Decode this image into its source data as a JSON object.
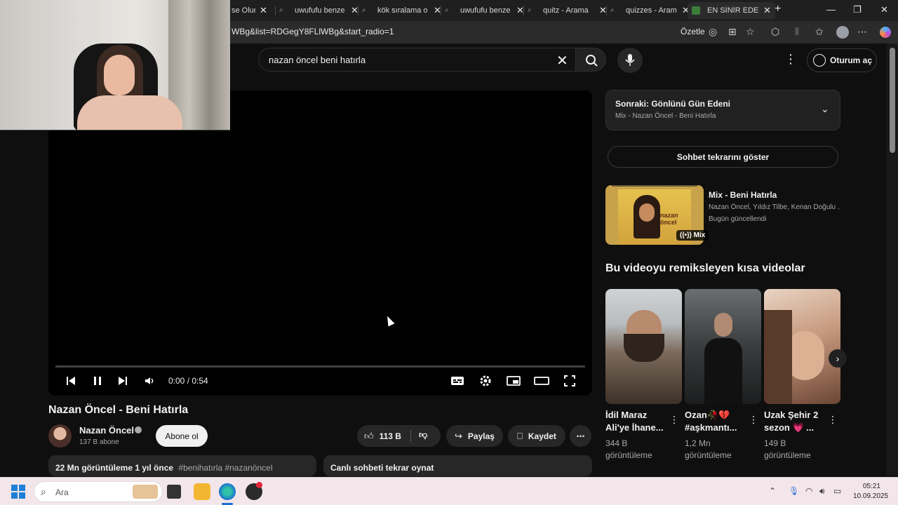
{
  "browser": {
    "tabs": [
      {
        "title": "se Olur",
        "icon": "generic-icon"
      },
      {
        "title": "uwufufu benze",
        "icon": "search-icon"
      },
      {
        "title": "kök sıralama o",
        "icon": "search-icon"
      },
      {
        "title": "uwufufu benze",
        "icon": "search-icon"
      },
      {
        "title": "quitz - Arama",
        "icon": "search-icon"
      },
      {
        "title": "quizzes - Aram",
        "icon": "search-icon"
      },
      {
        "title": "EN SİNİR EDEN",
        "icon": "game-icon"
      }
    ],
    "url": "WBg&list=RDGegY8FLlWBg&start_radio=1",
    "summarize_label": "Özetle"
  },
  "masthead": {
    "search_query": "nazan öncel beni hatırla",
    "signin_label": "Oturum aç"
  },
  "player": {
    "time": "0:00 / 0:54",
    "progress_fraction": 0.0
  },
  "video": {
    "title": "Nazan Öncel - Beni Hatırla",
    "channel": "Nazan Öncel",
    "subscribers": "137 B abone",
    "subscribe_label": "Abone ol",
    "likes": "113 B",
    "share_label": "Paylaş",
    "save_label": "Kaydet",
    "views_time": "22 Mn görüntüleme  1 yıl önce",
    "hashtags": "#benihatırla #nazanöncel",
    "chat_replay_box": "Canlı sohbeti tekrar oynat"
  },
  "sidebar": {
    "next_title": "Sonraki: Gönlünü Gün Edeni",
    "next_subtitle": "Mix - Nazan Öncel - Beni Hatırla",
    "chat_replay_button": "Sohbet tekrarını göster",
    "mix": {
      "title": "Mix - Beni Hatırla",
      "artists": "Nazan Öncel, Yıldız Tilbe, Kenan Doğulu ...",
      "updated": "Bugün güncellendi",
      "badge": "Mix",
      "cover_text": "nazan öncel"
    },
    "shorts_heading": "Bu videoyu remiksleyen kısa videolar",
    "shorts": [
      {
        "title": "İdil Maraz Ali'ye İhane...",
        "views": "344 B görüntüleme"
      },
      {
        "title": "Ozan🥀💔 #aşkmantı...",
        "views": "1,2 Mn görüntüleme"
      },
      {
        "title": "Uzak Şehir 2 sezon 💗 ...",
        "views": "149 B görüntüleme"
      }
    ]
  },
  "taskbar": {
    "search_placeholder": "Ara",
    "time": "05:21",
    "date": "10.09.2025"
  }
}
